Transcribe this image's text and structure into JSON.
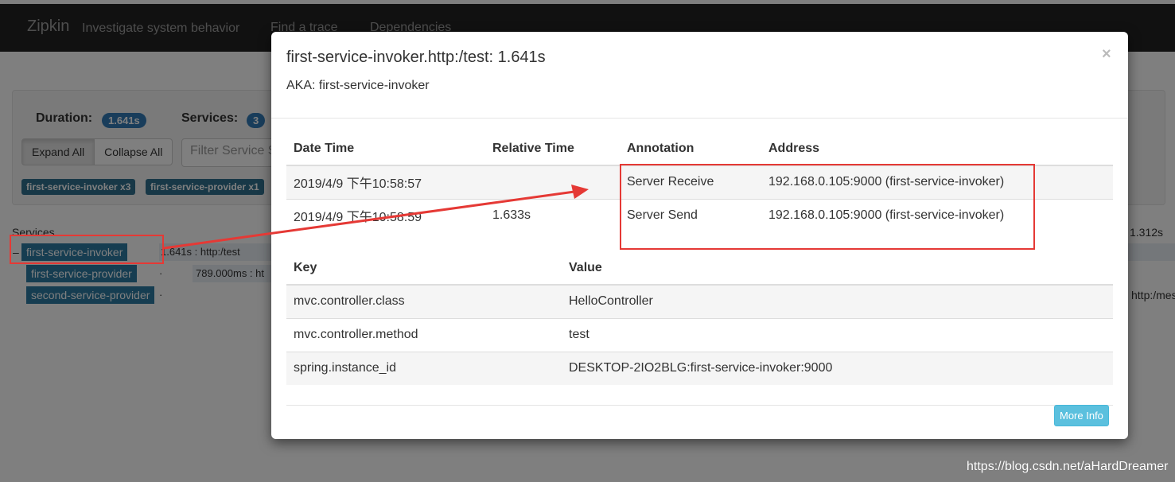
{
  "navbar": {
    "brand": "Zipkin",
    "subtitle": "Investigate system behavior",
    "links": [
      "Find a trace",
      "Dependencies"
    ]
  },
  "summary": {
    "duration_label": "Duration:",
    "duration_value": "1.641s",
    "services_label": "Services:",
    "services_value": "3",
    "expand_all": "Expand All",
    "collapse_all": "Collapse All",
    "filter_placeholder": "Filter Service S",
    "service_badges": [
      "first-service-invoker x3",
      "first-service-provider x1"
    ]
  },
  "tree": {
    "header": "Services",
    "toggle": "–",
    "nodes": [
      "first-service-invoker",
      "first-service-provider",
      "second-service-provider"
    ],
    "bar_texts": [
      "1.641s : http:/test",
      "789.000ms : ht"
    ],
    "dots": [
      "·",
      "·"
    ],
    "right_texts": [
      "1.312s",
      "http:/mes"
    ]
  },
  "modal": {
    "title": "first-service-invoker.http:/test: 1.641s",
    "aka": "AKA: first-service-invoker",
    "close": "×",
    "annotation_headers": [
      "Date Time",
      "Relative Time",
      "Annotation",
      "Address"
    ],
    "annotation_rows": [
      [
        "2019/4/9 下午10:58:57",
        "",
        "Server Receive",
        "192.168.0.105:9000 (first-service-invoker)"
      ],
      [
        "2019/4/9 下午10:58:59",
        "1.633s",
        "Server Send",
        "192.168.0.105:9000 (first-service-invoker)"
      ]
    ],
    "kv_headers": [
      "Key",
      "Value"
    ],
    "kv_rows": [
      [
        "mvc.controller.class",
        "HelloController"
      ],
      [
        "mvc.controller.method",
        "test"
      ],
      [
        "spring.instance_id",
        "DESKTOP-2IO2BLG:first-service-invoker:9000"
      ]
    ],
    "more_info": "More Info"
  },
  "watermark": "https://blog.csdn.net/aHardDreamer",
  "colors": {
    "navbar": "#222222",
    "badge": "#337ab7",
    "tree_node": "#2c7ba3",
    "more_info": "#5bc0de",
    "annotation_red": "#e53935"
  }
}
